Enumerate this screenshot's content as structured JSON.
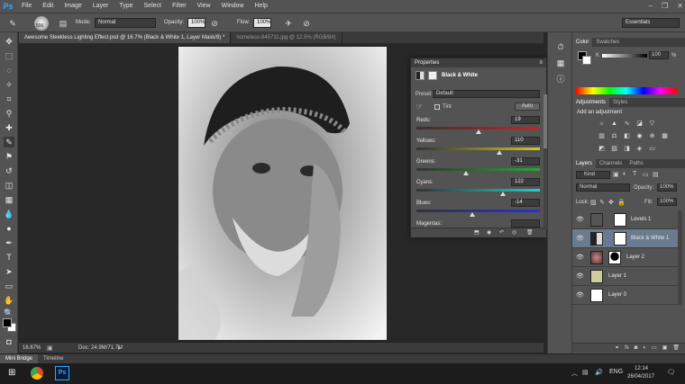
{
  "app": {
    "logo": "Ps"
  },
  "menu": {
    "items": [
      "File",
      "Edit",
      "Image",
      "Layer",
      "Type",
      "Select",
      "Filter",
      "View",
      "Window",
      "Help"
    ]
  },
  "window_controls": {
    "minimize": "–",
    "restore": "❐",
    "close": "✕"
  },
  "options": {
    "brush_size": "500",
    "mode_label": "Mode:",
    "mode_value": "Normal",
    "opacity_label": "Opacity:",
    "opacity_value": "100%",
    "flow_label": "Flow:",
    "flow_value": "100%",
    "workspace": "Essentials"
  },
  "documents": {
    "tabs": [
      {
        "label": "Awesome Sleekless Lighting Effect.psd @ 16.7% (Black & White 1, Layer Mask/8) *"
      },
      {
        "label": "homeless-845711.jpg @ 12.5% (RGB/8#)"
      }
    ]
  },
  "status": {
    "zoom": "16.67%",
    "doc_size": "Doc: 24.9M/71.7M"
  },
  "bottom_tabs": [
    "Mini Bridge",
    "Timeline"
  ],
  "properties": {
    "title": "Properties",
    "adjustment_name": "Black & White",
    "preset_label": "Preset:",
    "preset_value": "Default",
    "tint_label": "Tint",
    "auto_label": "Auto",
    "sliders": [
      {
        "label": "Reds:",
        "value": "19",
        "fraction": 0.5,
        "gradient": "#333,#cc2222"
      },
      {
        "label": "Yellows:",
        "value": "110",
        "fraction": 0.67,
        "gradient": "#333,#cccc22"
      },
      {
        "label": "Greens:",
        "value": "-31",
        "fraction": 0.4,
        "gradient": "#333,#22aa33"
      },
      {
        "label": "Cyans:",
        "value": "122",
        "fraction": 0.7,
        "gradient": "#333,#22cccc"
      },
      {
        "label": "Blues:",
        "value": "-14",
        "fraction": 0.45,
        "gradient": "#333,#2233dd"
      },
      {
        "label": "Magentas:",
        "value": "",
        "fraction": 0.5,
        "gradient": "#333,#cc22cc"
      }
    ]
  },
  "color_panel": {
    "tabs": [
      "Color",
      "Swatches"
    ],
    "value": "100",
    "unit": "%",
    "key_label": "K"
  },
  "adjustments_panel": {
    "tabs": [
      "Adjustments",
      "Styles"
    ],
    "heading": "Add an adjustment"
  },
  "layers_panel": {
    "tabs": [
      "Layers",
      "Channels",
      "Paths"
    ],
    "kind_label": "Kind",
    "blend_mode": "Normal",
    "opacity_label": "Opacity:",
    "opacity_value": "100%",
    "lock_label": "Lock:",
    "fill_label": "Fill:",
    "fill_value": "100%",
    "layers": [
      {
        "name": "Levels 1",
        "selected": false
      },
      {
        "name": "Black & White 1",
        "selected": true
      },
      {
        "name": "Layer 2",
        "selected": false
      },
      {
        "name": "Layer 1",
        "selected": false
      },
      {
        "name": "Layer 0",
        "selected": false
      }
    ],
    "footer_icons": [
      "⚭",
      "fx",
      "◙",
      "◐",
      "▭",
      "▣",
      "🗑"
    ]
  },
  "taskbar": {
    "time": "12:14",
    "date": "26/04/2017",
    "lang": "ENG"
  }
}
